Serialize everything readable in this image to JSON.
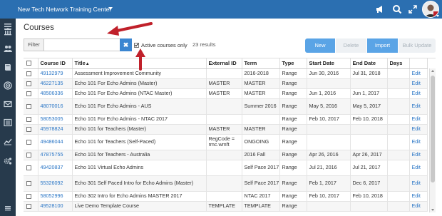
{
  "topbar": {
    "org_name": "New Tech Network Training Center"
  },
  "page": {
    "title": "Courses"
  },
  "filter": {
    "label": "Filter",
    "value": "",
    "placeholder": "",
    "clear_symbol": "✖"
  },
  "active_only": {
    "label": "Active courses only",
    "checked": true
  },
  "results": {
    "text": "23 results"
  },
  "buttons": {
    "new": "New",
    "delete": "Delete",
    "import": "Import",
    "bulk_update": "Bulk Update"
  },
  "table": {
    "headers": [
      "Course ID",
      "Title",
      "External ID",
      "Term",
      "Type",
      "Start Date",
      "End Date",
      "Days"
    ],
    "sort_indicator": "▲",
    "edit_label": "Edit",
    "rows": [
      {
        "id": "49132979",
        "title": "Assessment Improvement Community",
        "ext": "",
        "term": "2016-2018",
        "type": "Range",
        "start": "Jun 30, 2016",
        "end": "Jul 31, 2018",
        "days": ""
      },
      {
        "id": "46227135",
        "title": "Echo 101 For Echo Admins (Master)",
        "ext": "MASTER",
        "term": "MASTER",
        "type": "Range",
        "start": "",
        "end": "",
        "days": ""
      },
      {
        "id": "48506336",
        "title": "Echo 101 For Echo Admins (NTAC Master)",
        "ext": "MASTER",
        "term": "MASTER",
        "type": "Range",
        "start": "Jun 1, 2016",
        "end": "Jun 1, 2017",
        "days": ""
      },
      {
        "id": "48070016",
        "title": "Echo 101 For Echo Admins - AUS",
        "ext": "",
        "term": "Summer 2016",
        "type": "Range",
        "start": "May 5, 2016",
        "end": "May 5, 2017",
        "days": ""
      },
      {
        "id": "58053005",
        "title": "Echo 101 For Echo Admins - NTAC 2017",
        "ext": "",
        "term": "",
        "type": "Range",
        "start": "Feb 10, 2017",
        "end": "Feb 10, 2018",
        "days": ""
      },
      {
        "id": "45978824",
        "title": "Echo 101 for Teachers (Master)",
        "ext": "MASTER",
        "term": "MASTER",
        "type": "Range",
        "start": "",
        "end": "",
        "days": ""
      },
      {
        "id": "49486044",
        "title": "Echo 101 for Teachers (Self-Paced)",
        "ext": "RegCode = rmc.wmft",
        "term": "ONGOING",
        "type": "Range",
        "start": "",
        "end": "",
        "days": ""
      },
      {
        "id": "47875755",
        "title": "Echo 101 for Teachers - Australia",
        "ext": "",
        "term": "2016 Fall",
        "type": "Range",
        "start": "Apr 26, 2016",
        "end": "Apr 26, 2017",
        "days": ""
      },
      {
        "id": "49420837",
        "title": "Echo 101 Virtual Echo Admins",
        "ext": "",
        "term": "Self Pace 2017",
        "type": "Range",
        "start": "Jul 21, 2016",
        "end": "Jul 21, 2017",
        "days": ""
      },
      {
        "id": "55326092",
        "title": "Echo 301 Self Paced Intro for Echo Admins (Master)",
        "ext": "",
        "term": "Self Pace 2017",
        "type": "Range",
        "start": "Feb 1, 2017",
        "end": "Dec 6, 2017",
        "days": ""
      },
      {
        "id": "58052996",
        "title": "Echo 302 Intro for Echo Admins MASTER 2017",
        "ext": "",
        "term": "NTAC 2017",
        "type": "Range",
        "start": "Feb 10, 2017",
        "end": "Feb 10, 2018",
        "days": ""
      },
      {
        "id": "49528100",
        "title": "Live Demo Template Course",
        "ext": "TEMPLATE",
        "term": "TEMPLATE",
        "type": "Range",
        "start": "",
        "end": "",
        "days": ""
      }
    ]
  },
  "colors": {
    "topbar": "#2b6fb1",
    "sidebar": "#273a4c",
    "accent": "#5aa4e6",
    "link": "#2a76c6",
    "annotation": "#c0202a"
  }
}
